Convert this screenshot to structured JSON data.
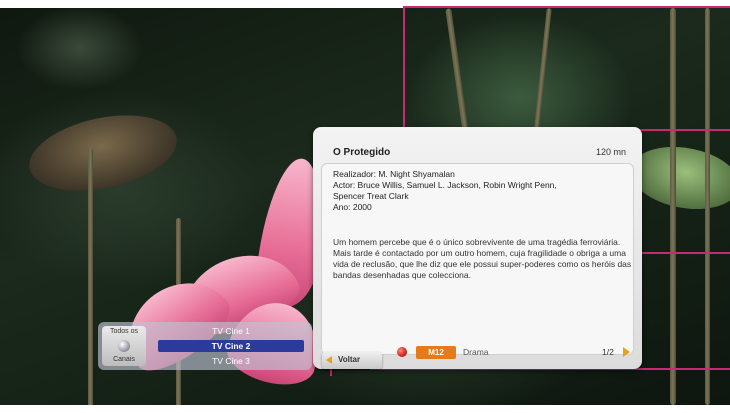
{
  "panel": {
    "title": "O Protegido",
    "duration": "120 mn",
    "director": "Realizador: M. Night Shyamalan",
    "actors_line1": "Actor: Bruce Willis, Samuel L. Jackson, Robin Wright Penn,",
    "actors_line2": "Spencer Treat Clark",
    "year": "Ano: 2000",
    "synopsis": "Um homem percebe que é o único sobrevivente de uma tragédia ferroviária. Mais tarde é contactado por um outro homem, cuja fragilidade o obriga a uma vida de reclusão, que lhe diz que ele possui super-poderes como os heróis das bandas desenhadas que colecciona.",
    "rating": "M12",
    "genre": "Drama",
    "page": "1/2"
  },
  "back_button": {
    "label": "Voltar"
  },
  "channels": {
    "category_top": "Todos os",
    "category_bottom": "Canais",
    "items": [
      "TV Cine 1",
      "TV Cine 2",
      "TV Cine 3"
    ],
    "selected_index": 1
  },
  "colors": {
    "accent_selected": "#2c3a9b",
    "rating_badge": "#e67a1b",
    "callout_line": "#c8296f",
    "arrow": "#e6a319"
  }
}
